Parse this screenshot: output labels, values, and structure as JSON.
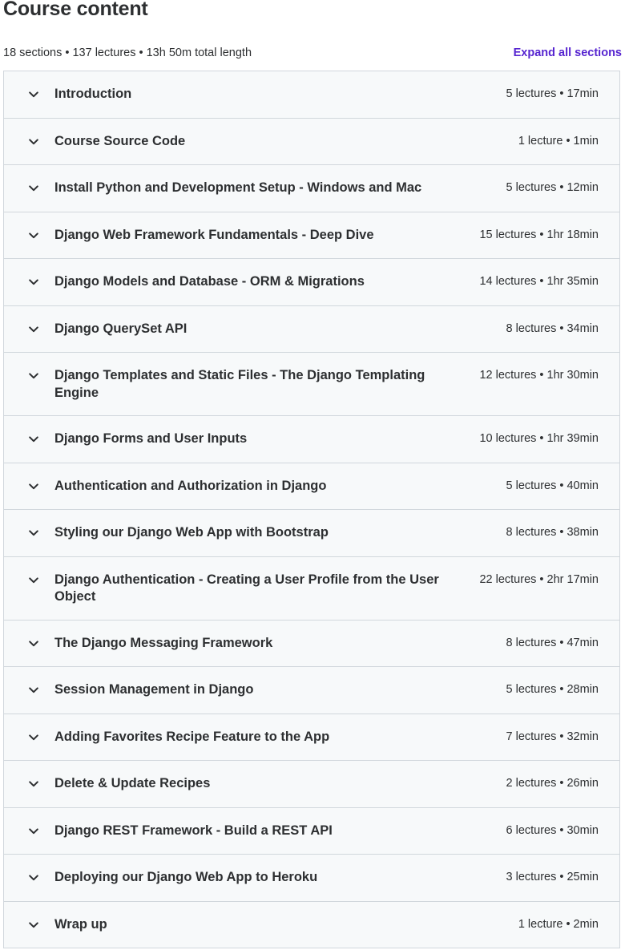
{
  "header": {
    "title": "Course content",
    "summary": "18 sections • 137 lectures • 13h 50m total length",
    "expand_label": "Expand all sections"
  },
  "icons": {
    "section_toggle": "chevron-down-icon"
  },
  "colors": {
    "accent": "#5624d0",
    "section_bg": "#f7f9fa",
    "border": "#d1d7dc",
    "text": "#2d2f31"
  },
  "sections": [
    {
      "title": "Introduction",
      "meta": "5 lectures • 17min"
    },
    {
      "title": "Course Source Code",
      "meta": "1 lecture • 1min"
    },
    {
      "title": "Install Python and Development Setup - Windows and Mac",
      "meta": "5 lectures • 12min"
    },
    {
      "title": "Django Web Framework Fundamentals - Deep Dive",
      "meta": "15 lectures • 1hr 18min"
    },
    {
      "title": "Django Models and Database - ORM & Migrations",
      "meta": "14 lectures • 1hr 35min"
    },
    {
      "title": "Django QuerySet API",
      "meta": "8 lectures • 34min"
    },
    {
      "title": "Django Templates and Static Files - The Django Templating Engine",
      "meta": "12 lectures • 1hr 30min"
    },
    {
      "title": "Django Forms and User Inputs",
      "meta": "10 lectures • 1hr 39min"
    },
    {
      "title": "Authentication and Authorization in Django",
      "meta": "5 lectures • 40min"
    },
    {
      "title": "Styling our Django Web App with Bootstrap",
      "meta": "8 lectures • 38min"
    },
    {
      "title": "Django Authentication - Creating a User Profile from the User Object",
      "meta": "22 lectures • 2hr 17min"
    },
    {
      "title": "The Django Messaging Framework",
      "meta": "8 lectures • 47min"
    },
    {
      "title": "Session Management in Django",
      "meta": "5 lectures • 28min"
    },
    {
      "title": "Adding Favorites Recipe Feature to the App",
      "meta": "7 lectures • 32min"
    },
    {
      "title": "Delete & Update Recipes",
      "meta": "2 lectures • 26min"
    },
    {
      "title": "Django REST Framework - Build a REST API",
      "meta": "6 lectures • 30min"
    },
    {
      "title": "Deploying our Django Web App to Heroku",
      "meta": "3 lectures • 25min"
    },
    {
      "title": "Wrap up",
      "meta": "1 lecture • 2min"
    }
  ]
}
